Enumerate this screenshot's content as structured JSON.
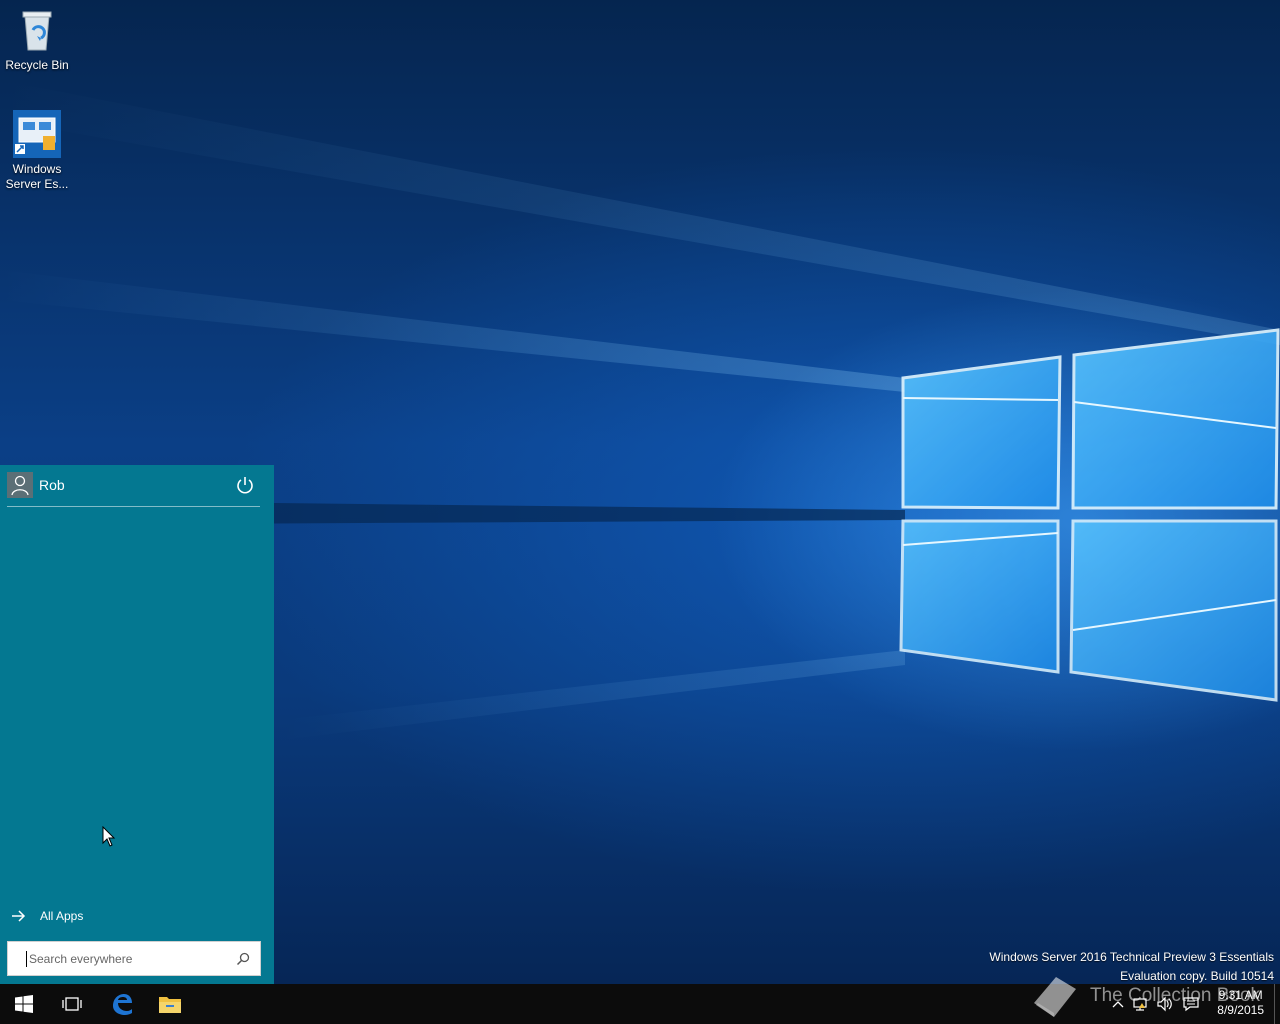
{
  "desktop": {
    "icons": [
      {
        "label": "Recycle Bin"
      },
      {
        "label": "Windows Server Es..."
      }
    ],
    "watermark_line1": "Windows Server 2016 Technical Preview 3 Essentials",
    "watermark_line2": "Evaluation copy. Build 10514",
    "brand_watermark": "The Collection Book"
  },
  "start_menu": {
    "user_name": "Rob",
    "all_apps_label": "All Apps",
    "search_placeholder": "Search everywhere"
  },
  "taskbar": {
    "time": "9:31 AM",
    "date": "8/9/2015"
  },
  "colors": {
    "start_menu_bg": "#047891",
    "taskbar_bg": "#0c0c0c",
    "edge_blue": "#1e74d2",
    "explorer_yellow": "#f0c040"
  }
}
